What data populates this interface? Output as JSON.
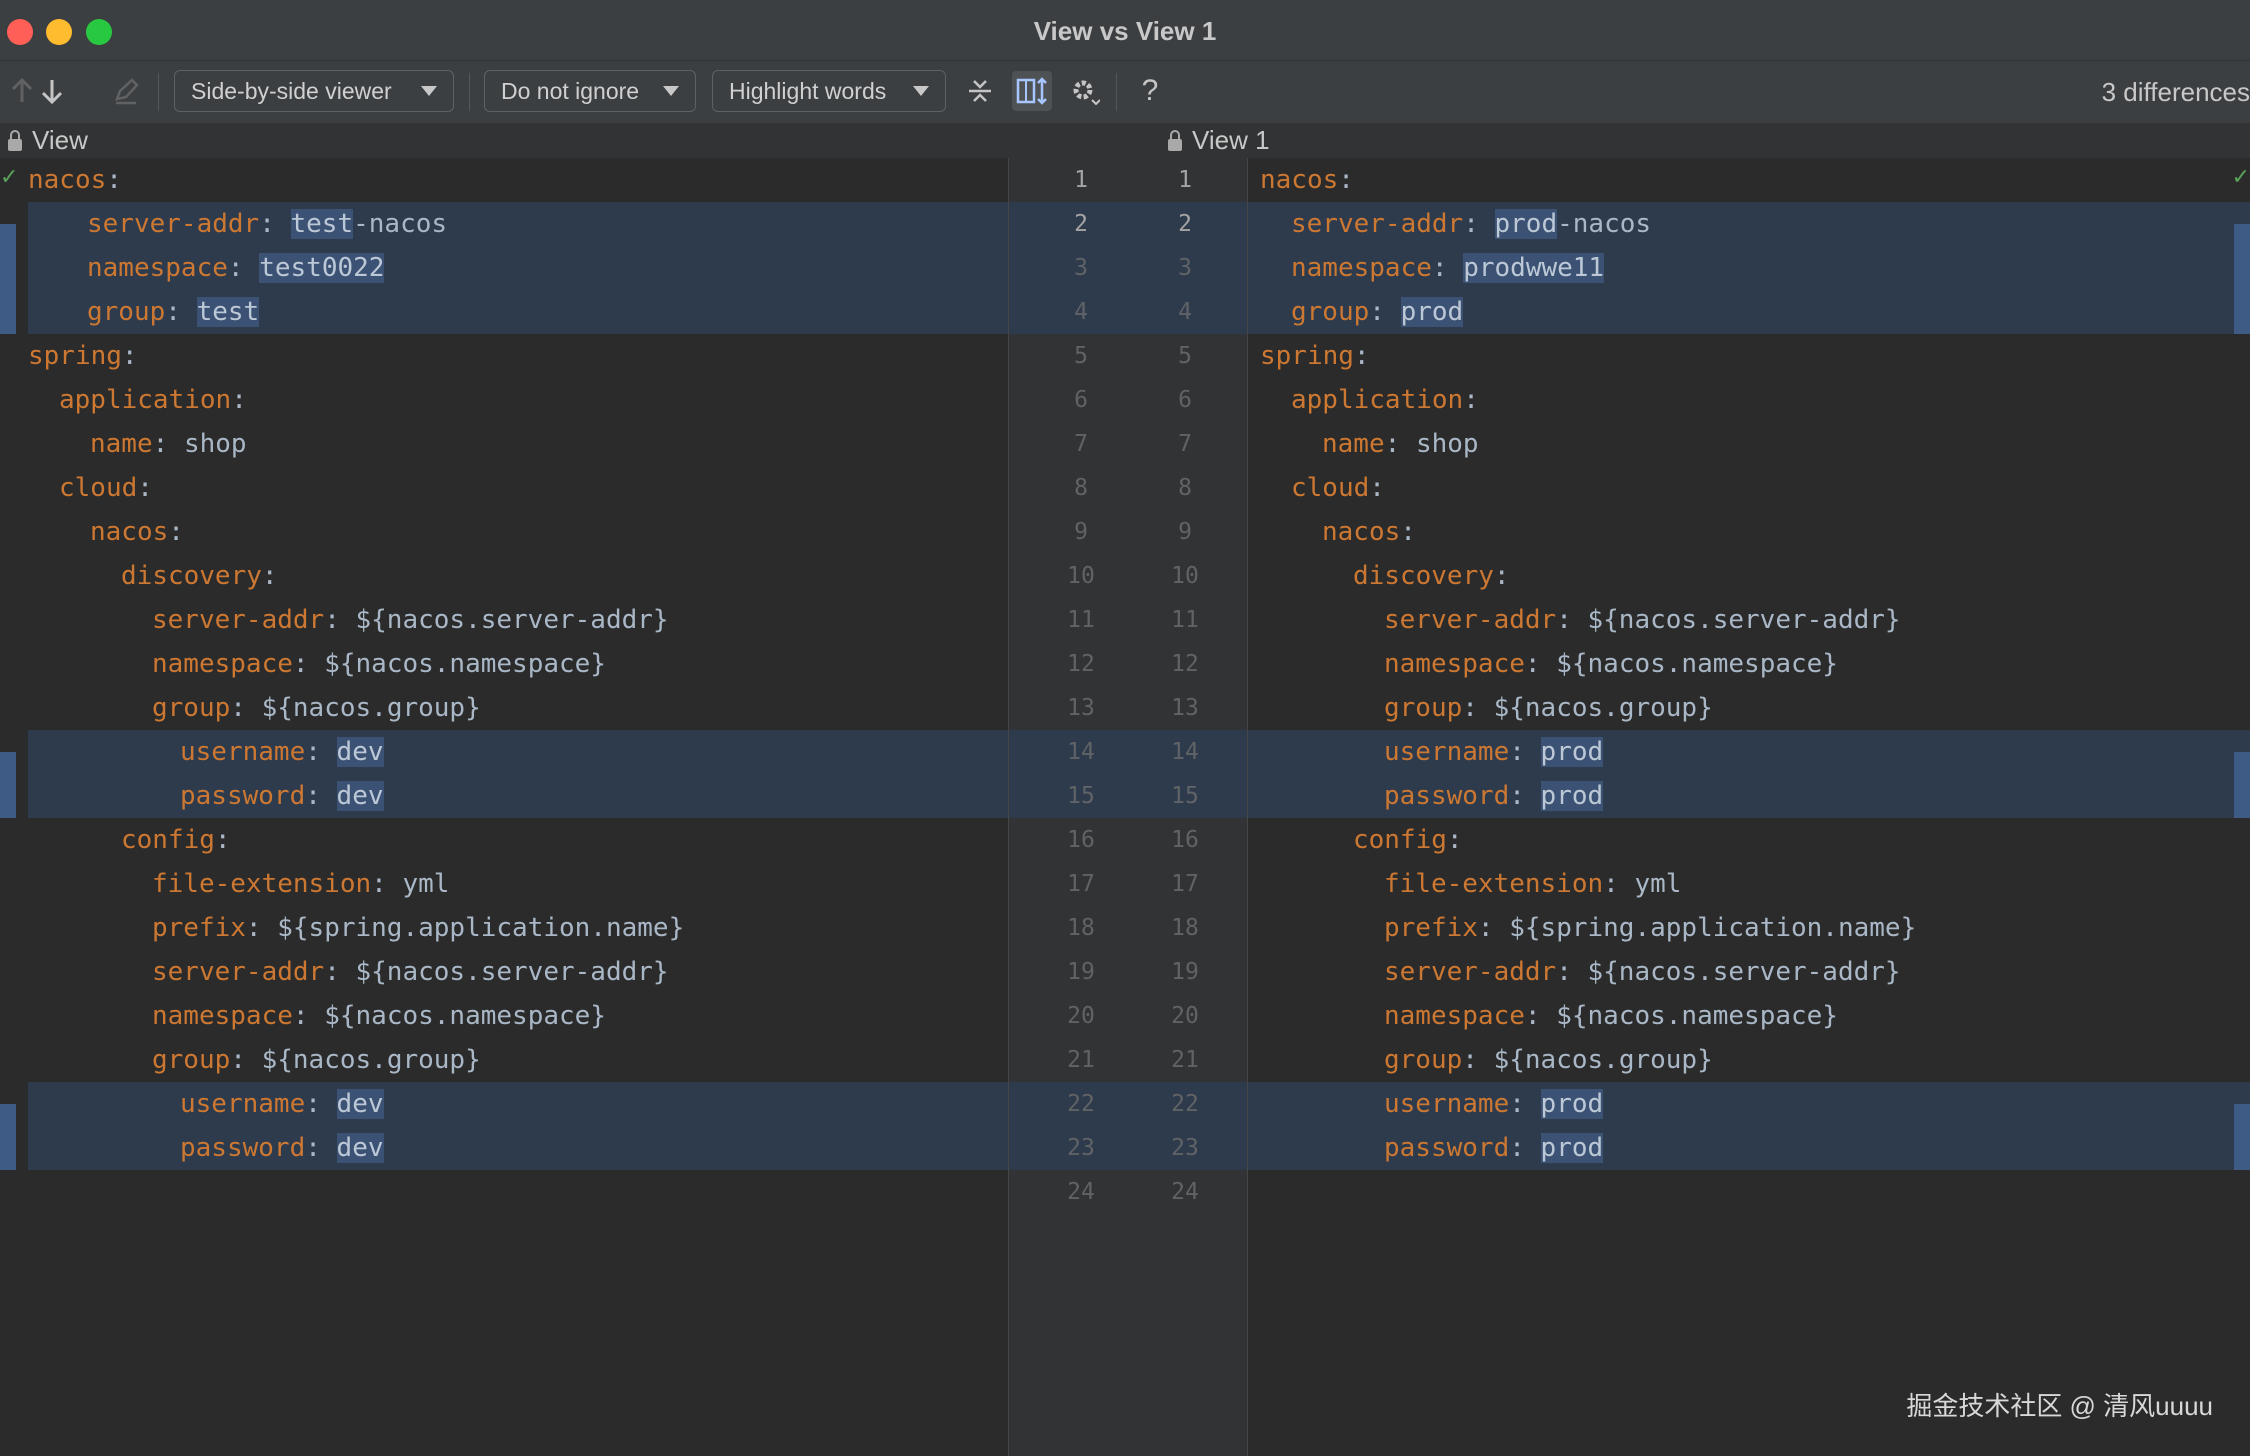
{
  "window": {
    "title": "View vs View 1"
  },
  "toolbar": {
    "viewer_mode": "Side-by-side viewer",
    "ignore_mode": "Do not ignore",
    "highlight_mode": "Highlight words",
    "help": "?",
    "diff_count": "3 differences"
  },
  "left_pane": {
    "title": "View"
  },
  "right_pane": {
    "title": "View 1"
  },
  "left_lines": [
    {
      "i": 0,
      "k": "nacos",
      "v": ""
    },
    {
      "i": 1,
      "k": "server-addr",
      "v": "test-nacos"
    },
    {
      "i": 1,
      "k": "namespace",
      "v": "test0022"
    },
    {
      "i": 1,
      "k": "group",
      "v": "test"
    },
    {
      "i": 0,
      "k": "spring",
      "v": ""
    },
    {
      "i": 1,
      "k": "application",
      "v": ""
    },
    {
      "i": 2,
      "k": "name",
      "v": "shop"
    },
    {
      "i": 1,
      "k": "cloud",
      "v": ""
    },
    {
      "i": 2,
      "k": "nacos",
      "v": ""
    },
    {
      "i": 3,
      "k": "discovery",
      "v": ""
    },
    {
      "i": 4,
      "k": "server-addr",
      "v": "${nacos.server-addr}"
    },
    {
      "i": 4,
      "k": "namespace",
      "v": "${nacos.namespace}"
    },
    {
      "i": 4,
      "k": "group",
      "v": "${nacos.group}"
    },
    {
      "i": 4,
      "k": "username",
      "v": "dev"
    },
    {
      "i": 4,
      "k": "password",
      "v": "dev"
    },
    {
      "i": 3,
      "k": "config",
      "v": ""
    },
    {
      "i": 4,
      "k": "file-extension",
      "v": "yml"
    },
    {
      "i": 4,
      "k": "prefix",
      "v": "${spring.application.name}"
    },
    {
      "i": 4,
      "k": "server-addr",
      "v": "${nacos.server-addr}"
    },
    {
      "i": 4,
      "k": "namespace",
      "v": "${nacos.namespace}"
    },
    {
      "i": 4,
      "k": "group",
      "v": "${nacos.group}"
    },
    {
      "i": 4,
      "k": "username",
      "v": "dev"
    },
    {
      "i": 4,
      "k": "password",
      "v": "dev"
    },
    {
      "i": 0,
      "k": "",
      "v": ""
    }
  ],
  "right_lines": [
    {
      "i": 0,
      "k": "nacos",
      "v": ""
    },
    {
      "i": 1,
      "k": "server-addr",
      "v": "prod-nacos"
    },
    {
      "i": 1,
      "k": "namespace",
      "v": "prodwwe11"
    },
    {
      "i": 1,
      "k": "group",
      "v": "prod"
    },
    {
      "i": 0,
      "k": "spring",
      "v": ""
    },
    {
      "i": 1,
      "k": "application",
      "v": ""
    },
    {
      "i": 2,
      "k": "name",
      "v": "shop"
    },
    {
      "i": 1,
      "k": "cloud",
      "v": ""
    },
    {
      "i": 2,
      "k": "nacos",
      "v": ""
    },
    {
      "i": 3,
      "k": "discovery",
      "v": ""
    },
    {
      "i": 4,
      "k": "server-addr",
      "v": "${nacos.server-addr}"
    },
    {
      "i": 4,
      "k": "namespace",
      "v": "${nacos.namespace}"
    },
    {
      "i": 4,
      "k": "group",
      "v": "${nacos.group}"
    },
    {
      "i": 4,
      "k": "username",
      "v": "prod"
    },
    {
      "i": 4,
      "k": "password",
      "v": "prod"
    },
    {
      "i": 3,
      "k": "config",
      "v": ""
    },
    {
      "i": 4,
      "k": "file-extension",
      "v": "yml"
    },
    {
      "i": 4,
      "k": "prefix",
      "v": "${spring.application.name}"
    },
    {
      "i": 4,
      "k": "server-addr",
      "v": "${nacos.server-addr}"
    },
    {
      "i": 4,
      "k": "namespace",
      "v": "${nacos.namespace}"
    },
    {
      "i": 4,
      "k": "group",
      "v": "${nacos.group}"
    },
    {
      "i": 4,
      "k": "username",
      "v": "prod"
    },
    {
      "i": 4,
      "k": "password",
      "v": "prod"
    },
    {
      "i": 0,
      "k": "",
      "v": ""
    }
  ],
  "changed_blocks": [
    [
      2,
      4
    ],
    [
      14,
      15
    ],
    [
      22,
      23
    ]
  ],
  "word_highlights": {
    "left": {
      "2": "test",
      "3": "test0022",
      "4": "test",
      "14": "dev",
      "15": "dev",
      "22": "dev",
      "23": "dev"
    },
    "right": {
      "2": "prod",
      "3": "prodwwe11",
      "4": "prod",
      "14": "prod",
      "15": "prod",
      "22": "prod",
      "23": "prod"
    }
  },
  "watermark": "掘金技术社区 @ 清风uuuu",
  "colors": {
    "background": "#2b2b2b",
    "key": "#cc7832",
    "text": "#a9b7c6",
    "changed_row": "#2e3b4d",
    "word_highlight": "#3c5275"
  }
}
